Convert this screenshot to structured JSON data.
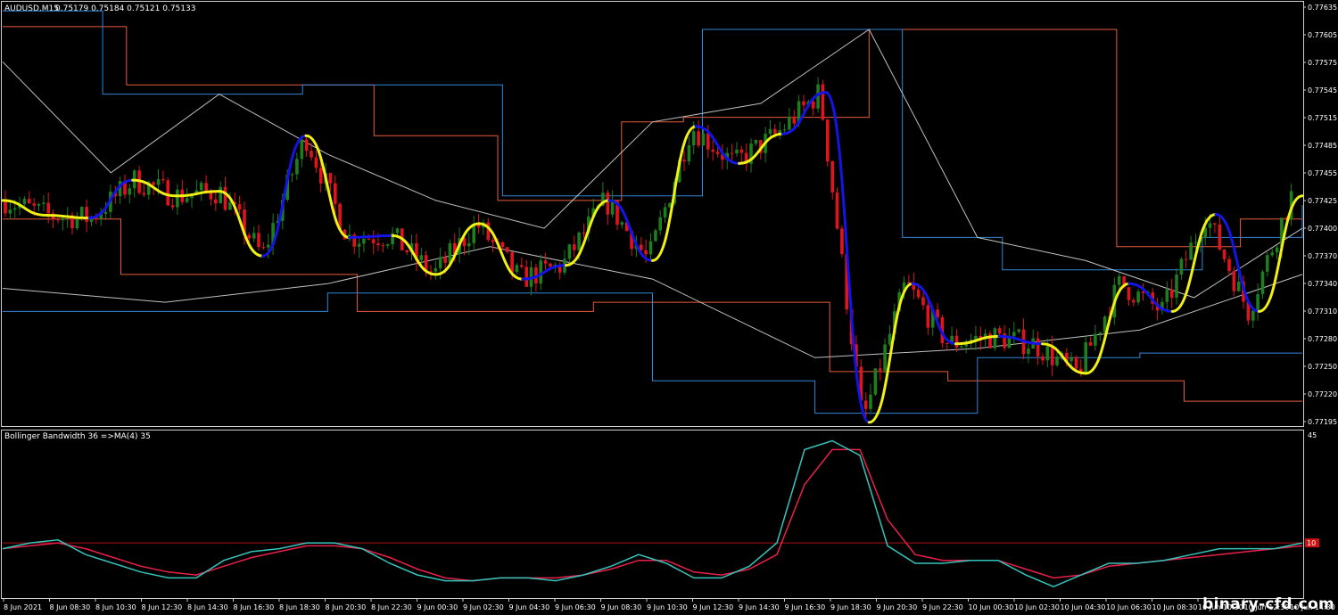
{
  "header": {
    "symbol": "AUDUSD,M15",
    "ohlc": "0.75179 0.75184 0.75121 0.75133"
  },
  "indicator": {
    "title": "Bollinger Bandwidth 36  =>MA(4) 35",
    "top_value": "45",
    "level_value": "10"
  },
  "watermark": "binary-cfd.com",
  "colors": {
    "background": "#000000",
    "bull": "#1e7d1e",
    "bear": "#e0141e",
    "ma_up": "#1414e6",
    "ma_down": "#f0f014",
    "band_outer": "#e85a3c",
    "band_mid": "#2f86d8",
    "band_inner": "#c0c0c0",
    "bw_line": "#35c4bc",
    "bw_ma": "#e8204a",
    "level_line": "#b01010"
  },
  "chart_data": [
    {
      "type": "candlestick",
      "title": "AUDUSD,M15",
      "y_ticks": [
        "0.77635",
        "0.77605",
        "0.77575",
        "0.77545",
        "0.77515",
        "0.77485",
        "0.77455",
        "0.77425",
        "0.77400",
        "0.77370",
        "0.77340",
        "0.77310",
        "0.77280",
        "0.77250",
        "0.77220",
        "0.77195"
      ],
      "ylim": [
        0.77188,
        0.77642
      ],
      "x_ticks": [
        "8 Jun 2021",
        "8 Jun 08:30",
        "8 Jun 10:30",
        "8 Jun 12:30",
        "8 Jun 14:30",
        "8 Jun 16:30",
        "8 Jun 18:30",
        "8 Jun 20:30",
        "8 Jun 22:30",
        "9 Jun 00:30",
        "9 Jun 02:30",
        "9 Jun 04:30",
        "9 Jun 06:30",
        "9 Jun 08:30",
        "9 Jun 10:30",
        "9 Jun 12:30",
        "9 Jun 14:30",
        "9 Jun 16:30",
        "9 Jun 18:30",
        "9 Jun 20:30",
        "9 Jun 22:30",
        "10 Jun 00:30",
        "10 Jun 02:30",
        "10 Jun 04:30",
        "10 Jun 06:30",
        "10 Jun 08:30",
        "10 Jun 10:30",
        "10 Jun 12:30",
        "10 Jun 14:30"
      ],
      "ma_path": [
        0.7743,
        0.77414,
        0.77411,
        0.77452,
        0.77435,
        0.7744,
        0.7737,
        0.775,
        0.7739,
        0.77392,
        0.7735,
        0.77405,
        0.77345,
        0.7736,
        0.7743,
        0.77365,
        0.7751,
        0.7747,
        0.77502,
        0.77547,
        0.7719,
        0.7734,
        0.77275,
        0.77283,
        0.77275,
        0.77243,
        0.7734,
        0.7731,
        0.77415,
        0.7731,
        0.77435
      ],
      "ma_trend": [
        "down",
        "down",
        "up",
        "down",
        "down",
        "down",
        "up",
        "down",
        "up",
        "down",
        "down",
        "down",
        "up",
        "down",
        "up",
        "down",
        "up",
        "down",
        "up",
        "up",
        "down",
        "up",
        "down",
        "up",
        "down",
        "down",
        "up",
        "down",
        "up",
        "down",
        "up"
      ],
      "band_outer_upper": [
        0.77618,
        0.77618,
        0.77555,
        0.77555,
        0.77555,
        0.77555,
        0.775,
        0.775,
        0.7743,
        0.7743,
        0.77515,
        0.7752,
        0.7752,
        0.7752,
        0.77615,
        0.77615,
        0.77615,
        0.77615,
        0.7738,
        0.7738,
        0.7741,
        0.7741
      ],
      "band_outer_lower": [
        0.7741,
        0.7735,
        0.7735,
        0.7731,
        0.7731,
        0.7732,
        0.7732,
        0.77245,
        0.77235,
        0.77235,
        0.77213,
        0.77213
      ],
      "band_mid_upper": [
        0.77635,
        0.77545,
        0.77545,
        0.77555,
        0.77555,
        0.77435,
        0.77435,
        0.77615,
        0.77615,
        0.7739,
        0.77355,
        0.77355,
        0.7739,
        0.77425
      ],
      "band_mid_lower": [
        0.7731,
        0.7731,
        0.7733,
        0.7733,
        0.77235,
        0.772,
        0.7726,
        0.77265,
        0.77265
      ],
      "band_inner_upper": [
        0.7758,
        0.7746,
        0.77545,
        0.7748,
        0.7743,
        0.774,
        0.77515,
        0.77535,
        0.77615,
        0.7739,
        0.77365,
        0.77325,
        0.774
      ],
      "band_inner_lower": [
        0.77335,
        0.7732,
        0.7734,
        0.7738,
        0.77345,
        0.7726,
        0.7727,
        0.7729,
        0.7735
      ]
    },
    {
      "type": "line",
      "title": "Bollinger Bandwidth 36  =>MA(4) 35",
      "series": [
        {
          "name": "Bollinger Bandwidth 36",
          "values": [
            8,
            10,
            11,
            6,
            3,
            0,
            -2,
            -2,
            4,
            7,
            8,
            10,
            10,
            8,
            3,
            -1,
            -3,
            -3,
            -2,
            -2,
            -3,
            -1,
            2,
            6,
            3,
            -2,
            -2,
            2,
            10,
            42,
            45,
            40,
            9,
            3,
            3,
            4,
            4,
            -1,
            -5,
            -1,
            3,
            3,
            4,
            6,
            8,
            8,
            8,
            10
          ]
        },
        {
          "name": "MA(4) 35",
          "values": [
            8,
            9,
            10,
            8,
            5,
            2,
            0,
            -1,
            2,
            5,
            7,
            9,
            9,
            8,
            5,
            1,
            -2,
            -3,
            -2,
            -2,
            -2,
            -1,
            1,
            4,
            4,
            0,
            -1,
            1,
            6,
            30,
            42,
            42,
            18,
            6,
            4,
            4,
            4,
            1,
            -2,
            -1,
            2,
            3,
            4,
            5,
            6,
            7,
            8,
            9
          ]
        }
      ],
      "ylim": [
        -8,
        47
      ],
      "levels": [
        10
      ]
    }
  ]
}
